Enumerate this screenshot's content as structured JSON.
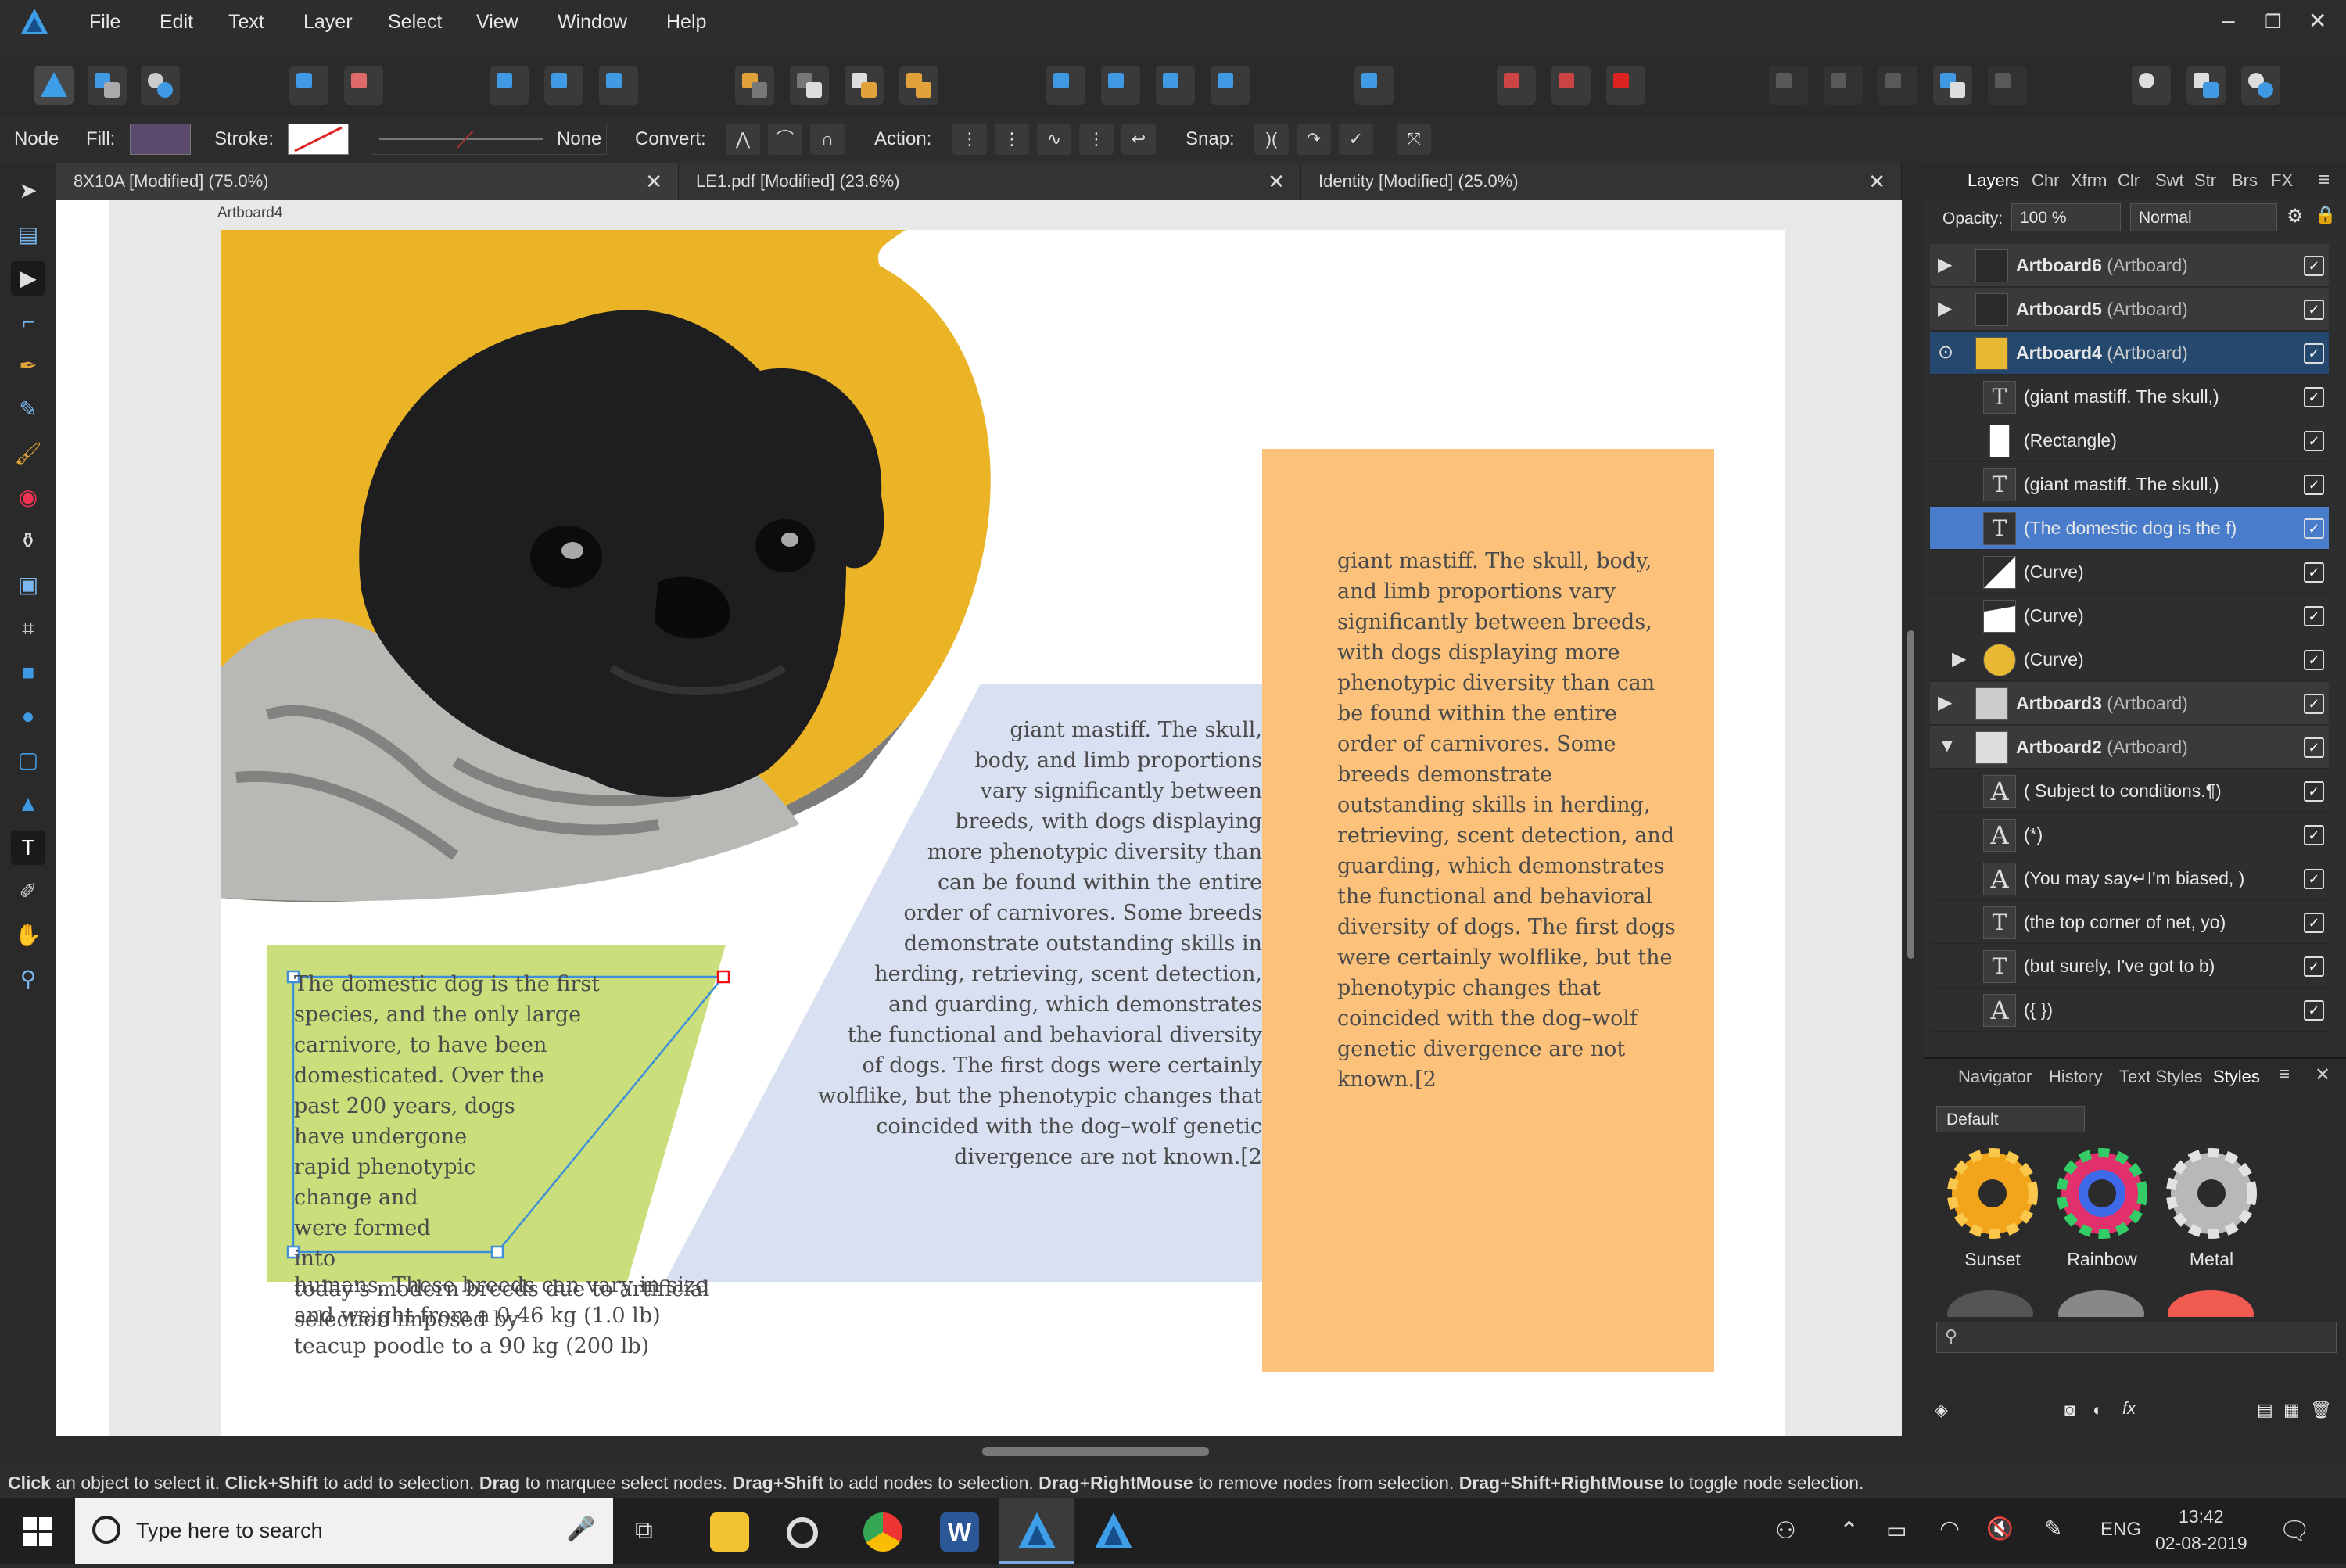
{
  "app": {
    "menu": [
      "File",
      "Edit",
      "Text",
      "Layer",
      "Select",
      "View",
      "Window",
      "Help"
    ]
  },
  "context_toolbar": {
    "mode": "Node",
    "fill_label": "Fill:",
    "stroke_label": "Stroke:",
    "stroke_value": "None",
    "convert_label": "Convert:",
    "action_label": "Action:",
    "snap_label": "Snap:"
  },
  "tabs": [
    {
      "label": "8X10A [Modified] (75.0%)"
    },
    {
      "label": "LE1.pdf [Modified] (23.6%)"
    },
    {
      "label": "Identity [Modified] (25.0%)"
    }
  ],
  "canvas": {
    "artboard_label": "Artboard4",
    "green_text": "The domestic dog is the first species, and the only large carnivore, to have been domesticated. Over the past 200 years, dogs have undergone rapid phenotypic change and were formed into today's modern breeds due to artificial selection imposed by",
    "overflow_text": "humans. These breeds can vary in size and weight from a 0.46 kg (1.0 lb) teacup poodle to a 90 kg (200 lb)",
    "blue_text": "giant mastiff. The skull, body, and limb proportions vary significantly between breeds, with dogs displaying more phenotypic diversity than can be found within the entire order of carnivores. Some breeds demonstrate outstanding skills in herding, retrieving, scent detection, and guarding, which demonstrates the functional and behavioral diversity of dogs. The first dogs were certainly wolflike, but the phenotypic changes that coincided with the dog–wolf genetic divergence are not known.[2",
    "orange_text": "giant mastiff. The skull, body, and limb proportions vary significantly between breeds, with dogs displaying more phenotypic diversity than can be found within the entire order of carnivores. Some breeds demonstrate outstanding skills in herding, retrieving, scent detection, and guarding, which demonstrates the functional and behavioral diversity of dogs. The first dogs were certainly wolflike, but the phenotypic changes that coincided with the dog–wolf genetic divergence are not known.[2"
  },
  "layers_panel": {
    "tabs": [
      "Layers",
      "Chr",
      "Xfrm",
      "Clr",
      "Swt",
      "Str",
      "Brs",
      "FX"
    ],
    "opacity_label": "Opacity:",
    "opacity_value": "100 %",
    "blend_mode": "Normal",
    "rows": [
      {
        "bold": "Artboard6",
        "rest": " (Artboard)"
      },
      {
        "bold": "Artboard5",
        "rest": " (Artboard)"
      },
      {
        "bold": "Artboard4",
        "rest": " (Artboard)"
      },
      {
        "bold": "",
        "rest": "(giant mastiff. The skull,)"
      },
      {
        "bold": "",
        "rest": "(Rectangle)"
      },
      {
        "bold": "",
        "rest": "(giant mastiff. The skull,)"
      },
      {
        "bold": "",
        "rest": "(The domestic dog is the f)"
      },
      {
        "bold": "",
        "rest": "(Curve)"
      },
      {
        "bold": "",
        "rest": "(Curve)"
      },
      {
        "bold": "",
        "rest": "(Curve)"
      },
      {
        "bold": "Artboard3",
        "rest": " (Artboard)"
      },
      {
        "bold": "Artboard2",
        "rest": " (Artboard)"
      },
      {
        "bold": "",
        "rest": "( Subject to conditions.¶)"
      },
      {
        "bold": "",
        "rest": "(*)"
      },
      {
        "bold": "",
        "rest": "(You may say↵I'm biased, )"
      },
      {
        "bold": "",
        "rest": "(the top corner of net, yo)"
      },
      {
        "bold": "",
        "rest": "(but surely, I've got to b)"
      },
      {
        "bold": "",
        "rest": "({     })"
      }
    ]
  },
  "styles_panel": {
    "tabs": [
      "Navigator",
      "History",
      "Text Styles",
      "Styles"
    ],
    "category": "Default",
    "presets": [
      "Sunset",
      "Rainbow",
      "Metal"
    ]
  },
  "status_bar": {
    "segments": [
      {
        "b": "Click",
        "t": " an object to select it. "
      },
      {
        "b": "Click",
        "t": "+"
      },
      {
        "b": "Shift",
        "t": " to add to selection. "
      },
      {
        "b": "Drag",
        "t": " to marquee select nodes. "
      },
      {
        "b": "Drag",
        "t": "+"
      },
      {
        "b": "Shift",
        "t": " to add nodes to selection. "
      },
      {
        "b": "Drag",
        "t": "+"
      },
      {
        "b": "RightMouse",
        "t": " to remove nodes from selection. "
      },
      {
        "b": "Drag",
        "t": "+"
      },
      {
        "b": "Shift",
        "t": "+"
      },
      {
        "b": "RightMouse",
        "t": " to toggle node selection."
      }
    ]
  },
  "taskbar": {
    "search_placeholder": "Type here to search",
    "language": "ENG",
    "time": "13:42",
    "date": "02-08-2019"
  }
}
